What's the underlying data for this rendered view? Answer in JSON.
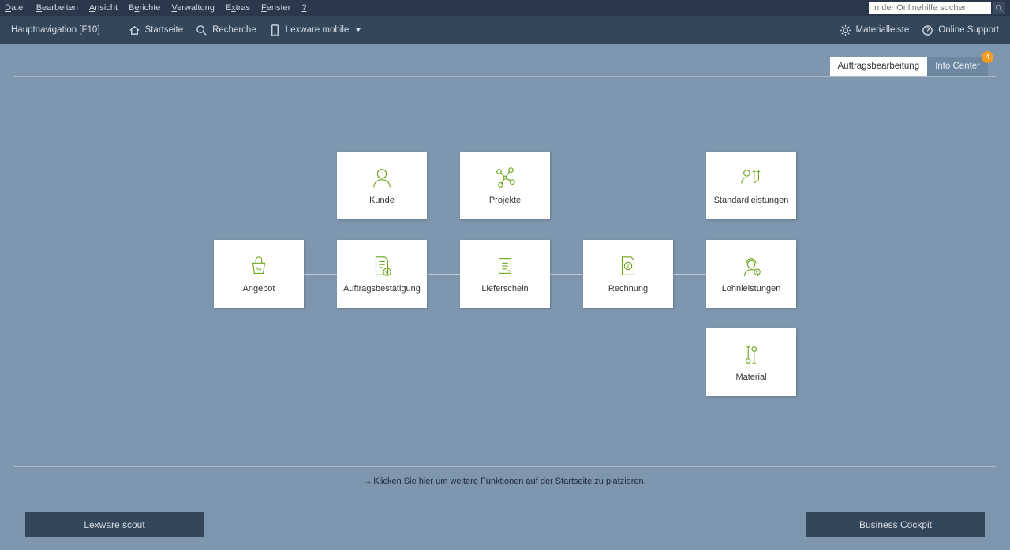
{
  "menu": {
    "items": [
      "Datei",
      "Bearbeiten",
      "Ansicht",
      "Berichte",
      "Verwaltung",
      "Extras",
      "Fenster",
      "?"
    ]
  },
  "search": {
    "placeholder": "In der Onlinehilfe suchen"
  },
  "toolbar": {
    "nav_label": "Hauptnavigation [F10]",
    "startseite": "Startseite",
    "recherche": "Recherche",
    "mobile": "Lexware mobile",
    "materialleiste": "Materialleiste",
    "support": "Online Support"
  },
  "tabs": {
    "active": "Auftragsbearbeitung",
    "info": "Info Center",
    "info_badge": "4"
  },
  "tiles": {
    "kunde": "Kunde",
    "projekte": "Projekte",
    "standard": "Standardleistungen",
    "angebot": "Angebot",
    "auftragsbest": "Auftragsbestätigung",
    "lieferschein": "Lieferschein",
    "rechnung": "Rechnung",
    "lohn": "Lohnleistungen",
    "material": "Material"
  },
  "hint": {
    "link": "Klicken Sie hier",
    "rest": " um weitere Funktionen auf der Startseite zu platzieren."
  },
  "bottom": {
    "scout": "Lexware scout",
    "cockpit": "Business Cockpit"
  }
}
